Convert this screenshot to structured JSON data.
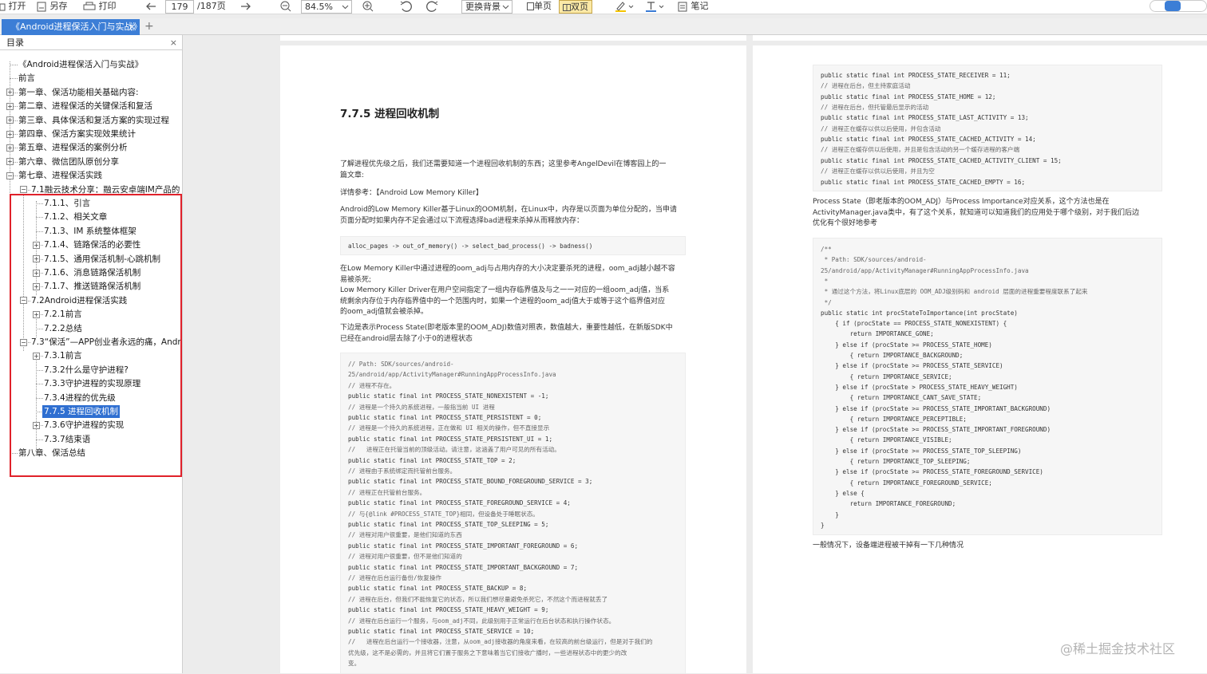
{
  "toolbar": {
    "open_label": "打开",
    "save_as_label": "另存",
    "print_label": "打印",
    "page_current": "179",
    "page_total": "/187页",
    "zoom_value": "84.5%",
    "background_label": "更换背景",
    "single_page_label": "单页",
    "double_page_label": "双页",
    "note_label": "笔记",
    "icons": [
      "folder-icon",
      "save-icon",
      "printer-icon",
      "arrow-left-icon",
      "arrow-right-icon",
      "zoom-out-icon",
      "chevron-down-icon",
      "zoom-in-icon",
      "rotate-left-icon",
      "rotate-right-icon",
      "highlighter-icon",
      "text-tool-icon",
      "note-icon"
    ]
  },
  "tab": {
    "title": "《Android进程保活入门与实战》",
    "close": "×",
    "new": "+"
  },
  "sidebar": {
    "title": "目录",
    "close": "×"
  },
  "toc": [
    {
      "label": "《Android进程保活入门与实战》",
      "level": 0,
      "exp": ""
    },
    {
      "label": "前言",
      "level": 0,
      "exp": ""
    },
    {
      "label": "第一章、保活功能相关基础内容:",
      "level": 0,
      "exp": "+"
    },
    {
      "label": "第二章、进程保活的关键保活和复活",
      "level": 0,
      "exp": "+"
    },
    {
      "label": "第三章、具体保活和复活方案的实现过程",
      "level": 0,
      "exp": "+"
    },
    {
      "label": "第四章、保活方案实现效果统计",
      "level": 0,
      "exp": "+"
    },
    {
      "label": "第五章、进程保活的案例分析",
      "level": 0,
      "exp": "+"
    },
    {
      "label": "第六章、微信团队原创分享",
      "level": 0,
      "exp": "+"
    },
    {
      "label": "第七章、进程保活实践",
      "level": 0,
      "exp": "-"
    },
    {
      "label": "7.1融云技术分享：融云安卓端IM产品的",
      "level": 1,
      "exp": "-"
    },
    {
      "label": "7.1.1、引言",
      "level": 2,
      "exp": ""
    },
    {
      "label": "7.1.2、相关文章",
      "level": 2,
      "exp": ""
    },
    {
      "label": "7.1.3、IM 系统整体框架",
      "level": 2,
      "exp": ""
    },
    {
      "label": "7.1.4、链路保活的必要性",
      "level": 2,
      "exp": "+"
    },
    {
      "label": "7.1.5、通用保活机制-心跳机制",
      "level": 2,
      "exp": "+"
    },
    {
      "label": "7.1.6、消息链路保活机制",
      "level": 2,
      "exp": "+"
    },
    {
      "label": "7.1.7、推送链路保活机制",
      "level": 2,
      "exp": "+"
    },
    {
      "label": "7.2Android进程保活实践",
      "level": 1,
      "exp": "-"
    },
    {
      "label": "7.2.1前言",
      "level": 2,
      "exp": "+"
    },
    {
      "label": "7.2.2总结",
      "level": 2,
      "exp": ""
    },
    {
      "label": "7.3“保活”—APP创业者永远的痛，Andro",
      "level": 1,
      "exp": "-"
    },
    {
      "label": "7.3.1前言",
      "level": 2,
      "exp": "+"
    },
    {
      "label": "7.3.2什么是守护进程?",
      "level": 2,
      "exp": ""
    },
    {
      "label": "7.3.3守护进程的实现原理",
      "level": 2,
      "exp": ""
    },
    {
      "label": "7.3.4进程的优先级",
      "level": 2,
      "exp": ""
    },
    {
      "label": "7.7.5 进程回收机制",
      "level": 2,
      "exp": "",
      "selected": true
    },
    {
      "label": "7.3.6守护进程的实现",
      "level": 2,
      "exp": "+"
    },
    {
      "label": "7.3.7结束语",
      "level": 2,
      "exp": ""
    },
    {
      "label": "第八章、保活总结",
      "level": 0,
      "exp": ""
    }
  ],
  "left_page": {
    "heading": "7.7.5 进程回收机制",
    "para1": [
      "了解进程优先级之后，我们还需要知道一个进程回收机制的东西；这里参考AngelDevil在博客园上的一",
      "篇文章:"
    ],
    "ref": "详情参考：【Android Low Memory Killer】",
    "para2": [
      "Android的Low Memory Killer基于Linux的OOM机制，在Linux中，内存是以页面为单位分配的，当申请",
      "页面分配时如果内存不足会通过以下流程选择bad进程来杀掉从而释放内存："
    ],
    "code1": "alloc_pages -> out_of_memory() -> select_bad_process() -> badness()",
    "para3": [
      "在Low Memory Killer中通过进程的oom_adj与占用内存的大小决定要杀死的进程，oom_adj越小越不容",
      "易被杀死;",
      "Low Memory  Killer  Driver在用户空间指定了一组内存临界值及与之一一对应的一组oom_adj值，当系",
      "统剩余内存位于内存临界值中的一个范围内时，如果一个进程的oom_adj值大于或等于这个临界值对应",
      "的oom_adj值就会被杀掉。"
    ],
    "para4": [
      "下边是表示Process  State(即老版本里的OOM_ADJ)数值对照表，数值越大，重要性越低，在新版SDK中",
      "已经在android层去除了小于0的进程状态"
    ],
    "code2": [
      {
        "t": "// Path: SDK/sources/android-",
        "c": true
      },
      {
        "t": "25/android/app/ActivityManager#RunningAppProcessInfo.java",
        "c": true
      },
      {
        "t": "// 进程不存在。",
        "c": true
      },
      {
        "t": "public static final int PROCESS_STATE_NONEXISTENT = -1;",
        "c": false
      },
      {
        "t": "// 进程是一个持久的系统进程，一般指当前 UI 进程",
        "c": true
      },
      {
        "t": "public static final int PROCESS_STATE_PERSISTENT = 0;",
        "c": false
      },
      {
        "t": "// 进程是一个持久的系统进程，正在做和 UI 相关的操作，但不直接显示",
        "c": true
      },
      {
        "t": "public static final int PROCESS_STATE_PERSISTENT_UI = 1;",
        "c": false
      },
      {
        "t": "//   进程正在托管当前的顶级活动。请注意，这涵盖了用户可见的所有活动。",
        "c": true
      },
      {
        "t": "public static final int PROCESS_STATE_TOP = 2;",
        "c": false
      },
      {
        "t": "// 进程由于系统绑定而托管前台服务。",
        "c": true
      },
      {
        "t": "public static final int PROCESS_STATE_BOUND_FOREGROUND_SERVICE = 3;",
        "c": false
      },
      {
        "t": "// 进程正在托管前台服务。",
        "c": true
      },
      {
        "t": "public static final int PROCESS_STATE_FOREGROUND_SERVICE = 4;",
        "c": false
      },
      {
        "t": "// 与{@link #PROCESS_STATE_TOP}相同，但设备处于睡眠状态。",
        "c": true
      },
      {
        "t": "public static final int PROCESS_STATE_TOP_SLEEPING = 5;",
        "c": false
      },
      {
        "t": "// 进程对用户很重要，是他们知道的东西",
        "c": true
      },
      {
        "t": "public static final int PROCESS_STATE_IMPORTANT_FOREGROUND = 6;",
        "c": false
      },
      {
        "t": "// 进程对用户很重要，但不是他们知道的",
        "c": true
      },
      {
        "t": "public static final int PROCESS_STATE_IMPORTANT_BACKGROUND = 7;",
        "c": false
      },
      {
        "t": "// 进程在后台运行备份/恢复操作",
        "c": true
      },
      {
        "t": "public static final int PROCESS_STATE_BACKUP = 8;",
        "c": false
      },
      {
        "t": "// 进程在后台，但我们不能恢复它的状态，所以我们想尽量避免杀死它，不然这个而进程就丢了",
        "c": true
      },
      {
        "t": "public static final int PROCESS_STATE_HEAVY_WEIGHT = 9;",
        "c": false
      },
      {
        "t": "// 进程在后台运行一个服务，与oom_adj不同，此级别用于正常运行在后台状态和执行操作状态。",
        "c": true
      },
      {
        "t": "public static final int PROCESS_STATE_SERVICE = 10;",
        "c": false
      },
      {
        "t": "//   进程在后台运行一个接收器，注意，从oom_adj接收器的角度来看，在较高的前台级运行，但是对于我们的",
        "c": true
      },
      {
        "t": "优先级，这不是必需的，并且将它们置于服务之下意味着当它们接收广播时，一些进程状态中的更少的改",
        "c": true
      },
      {
        "t": "变。",
        "c": true
      }
    ]
  },
  "right_page": {
    "code1": [
      {
        "t": "public static final int PROCESS_STATE_RECEIVER = 11;",
        "c": false
      },
      {
        "t": "// 进程在后台，但主持家庭活动",
        "c": true
      },
      {
        "t": "public static final int PROCESS_STATE_HOME = 12;",
        "c": false
      },
      {
        "t": "// 进程在后台，但托管最后显示的活动",
        "c": true
      },
      {
        "t": "public static final int PROCESS_STATE_LAST_ACTIVITY = 13;",
        "c": false
      },
      {
        "t": "// 进程正在缓存以供以后使用，并包含活动",
        "c": true
      },
      {
        "t": "public static final int PROCESS_STATE_CACHED_ACTIVITY = 14;",
        "c": false
      },
      {
        "t": "// 进程正在缓存供以后使用，并且是包含活动的另一个缓存进程的客户端",
        "c": true
      },
      {
        "t": "public static final int PROCESS_STATE_CACHED_ACTIVITY_CLIENT = 15;",
        "c": false
      },
      {
        "t": "// 进程正在缓存以供以后使用，并且为空",
        "c": true
      },
      {
        "t": "public static final int PROCESS_STATE_CACHED_EMPTY = 16;",
        "c": false
      }
    ],
    "para1": [
      "Process State（即老版本的OOM_ADJ）与Process Importance对应关系，这个方法也是在",
      "ActivityManager.java类中，有了这个关系，就知道可以知道我们的应用处于哪个级别，对于我们后边",
      "优化有个很好地参考"
    ],
    "code2": [
      {
        "t": "/**",
        "c": true
      },
      {
        "t": " * Path: SDK/sources/android-",
        "c": true
      },
      {
        "t": "25/android/app/ActivityManager#RunningAppProcessInfo.java",
        "c": true
      },
      {
        "t": " *",
        "c": true
      },
      {
        "t": " * 通过这个方法，将Linux底层的 OOM_ADJ级别码和 android 层面的进程重要程度联系了起来",
        "c": true
      },
      {
        "t": " */",
        "c": true
      },
      {
        "t": "public static int procStateToImportance(int procState)",
        "c": false
      },
      {
        "t": "    { if (procState == PROCESS_STATE_NONEXISTENT) {",
        "c": false
      },
      {
        "t": "        return IMPORTANCE_GONE;",
        "c": false
      },
      {
        "t": "    } else if (procState >= PROCESS_STATE_HOME)",
        "c": false
      },
      {
        "t": "        { return IMPORTANCE_BACKGROUND;",
        "c": false
      },
      {
        "t": "    } else if (procState >= PROCESS_STATE_SERVICE)",
        "c": false
      },
      {
        "t": "        { return IMPORTANCE_SERVICE;",
        "c": false
      },
      {
        "t": "    } else if (procState > PROCESS_STATE_HEAVY_WEIGHT)",
        "c": false
      },
      {
        "t": "        { return IMPORTANCE_CANT_SAVE_STATE;",
        "c": false
      },
      {
        "t": "    } else if (procState >= PROCESS_STATE_IMPORTANT_BACKGROUND)",
        "c": false
      },
      {
        "t": "        { return IMPORTANCE_PERCEPTIBLE;",
        "c": false
      },
      {
        "t": "    } else if (procState >= PROCESS_STATE_IMPORTANT_FOREGROUND)",
        "c": false
      },
      {
        "t": "        { return IMPORTANCE_VISIBLE;",
        "c": false
      },
      {
        "t": "    } else if (procState >= PROCESS_STATE_TOP_SLEEPING)",
        "c": false
      },
      {
        "t": "        { return IMPORTANCE_TOP_SLEEPING;",
        "c": false
      },
      {
        "t": "    } else if (procState >= PROCESS_STATE_FOREGROUND_SERVICE)",
        "c": false
      },
      {
        "t": "        { return IMPORTANCE_FOREGROUND_SERVICE;",
        "c": false
      },
      {
        "t": "    } else {",
        "c": false
      },
      {
        "t": "        return IMPORTANCE_FOREGROUND;",
        "c": false
      },
      {
        "t": "    }",
        "c": false
      },
      {
        "t": "}",
        "c": false
      }
    ],
    "para2": "一般情况下，设备端进程被干掉有一下几种情况"
  },
  "watermark": "@稀土掘金技术社区",
  "colors": {
    "tab_active": "#3c7ed6",
    "selection": "#2f6fd1",
    "highlight_border": "#e0212a",
    "toggle_active": "#fbe9a6"
  }
}
